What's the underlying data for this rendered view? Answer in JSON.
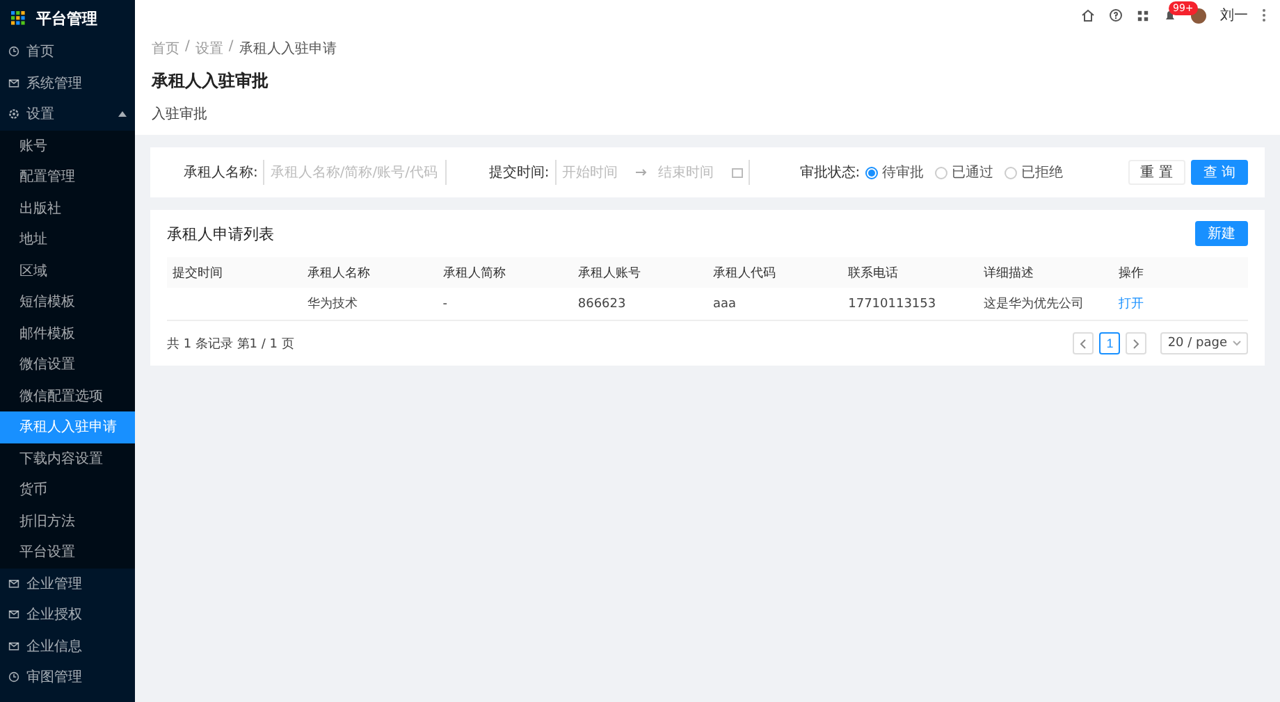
{
  "sidebar": {
    "title": "平台管理",
    "items": [
      {
        "label": "首页",
        "kind": "clock",
        "selected": false
      },
      {
        "label": "系统管理",
        "kind": "mail",
        "selected": false
      },
      {
        "label": "设置",
        "kind": "gear",
        "expanded": true,
        "selected": false,
        "children": [
          {
            "label": "账号",
            "selected": false
          },
          {
            "label": "配置管理",
            "selected": false
          },
          {
            "label": "出版社",
            "selected": false
          },
          {
            "label": "地址",
            "selected": false
          },
          {
            "label": "区域",
            "selected": false
          },
          {
            "label": "短信模板",
            "selected": false
          },
          {
            "label": "邮件模板",
            "selected": false
          },
          {
            "label": "微信设置",
            "selected": false
          },
          {
            "label": "微信配置选项",
            "selected": false
          },
          {
            "label": "承租人入驻申请",
            "selected": true
          },
          {
            "label": "下载内容设置",
            "selected": false
          },
          {
            "label": "货币",
            "selected": false
          },
          {
            "label": "折旧方法",
            "selected": false
          },
          {
            "label": "平台设置",
            "selected": false
          }
        ]
      },
      {
        "label": "企业管理",
        "kind": "mail",
        "selected": false
      },
      {
        "label": "企业授权",
        "kind": "mail",
        "selected": false
      },
      {
        "label": "企业信息",
        "kind": "mail",
        "selected": false
      },
      {
        "label": "审图管理",
        "kind": "clock",
        "selected": false
      }
    ]
  },
  "topbar": {
    "badge": "99+",
    "user": "刘一"
  },
  "breadcrumb": {
    "separator": "/",
    "items": [
      "首页",
      "设置",
      "承租人入驻申请"
    ]
  },
  "page_title": "承租人入驻审批",
  "page_subtitle": "入驻审批",
  "filters": {
    "name_label": "承租人名称:",
    "name_placeholder": "承租人名称/简称/账号/代码",
    "time_label": "提交时间:",
    "start_placeholder": "开始时间",
    "end_placeholder": "结束时间",
    "status_label": "审批状态:",
    "statuses": [
      {
        "label": "待审批",
        "selected": true
      },
      {
        "label": "已通过",
        "selected": false
      },
      {
        "label": "已拒绝",
        "selected": false
      }
    ],
    "reset": "重 置",
    "search": "查 询"
  },
  "table": {
    "title": "承租人申请列表",
    "new_button": "新建",
    "columns": [
      "提交时间",
      "承租人名称",
      "承租人简称",
      "承租人账号",
      "承租人代码",
      "联系电话",
      "详细描述",
      "操作"
    ],
    "rows": [
      {
        "cells": [
          null,
          "华为技术",
          "-",
          "866623",
          "aaa",
          "17710113153",
          "这是华为优先公司"
        ],
        "action": "打开"
      }
    ],
    "summary": "共 1 条记录 第1 / 1 页",
    "pages": [
      {
        "label": "1",
        "selected": true
      }
    ],
    "page_size": "20 / page"
  }
}
